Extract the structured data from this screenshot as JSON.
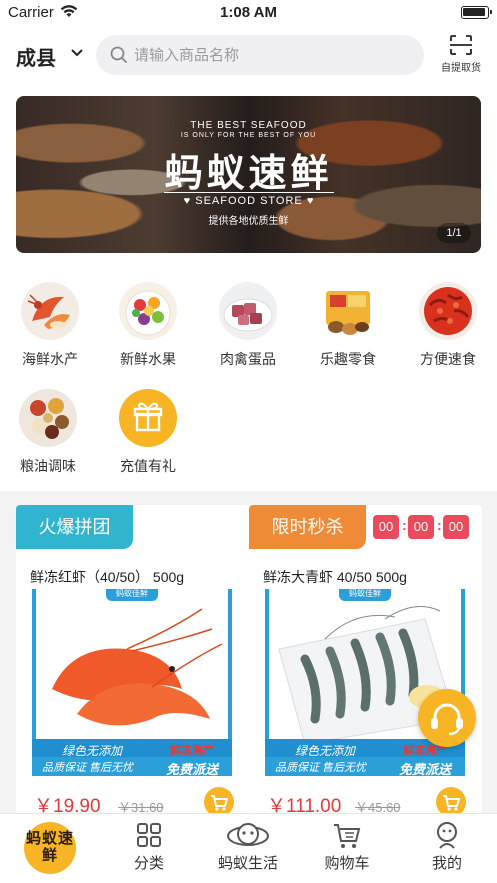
{
  "status_bar": {
    "carrier": "Carrier",
    "time": "1:08 AM"
  },
  "header": {
    "city": "成县",
    "search_placeholder": "请输入商品名称",
    "scan_label": "自提取货"
  },
  "banner": {
    "line1": "THE BEST SEAFOOD",
    "line2": "IS ONLY FOR THE BEST OF YOU",
    "title": "蚂蚁速鲜",
    "store": "♥ SEAFOOD STORE ♥",
    "subtitle": "提供各地优质生鲜",
    "pager": "1/1"
  },
  "categories": [
    {
      "label": "海鲜水产",
      "icon": "seafood-icon"
    },
    {
      "label": "新鲜水果",
      "icon": "fruit-icon"
    },
    {
      "label": "肉禽蛋品",
      "icon": "meat-icon"
    },
    {
      "label": "乐趣零食",
      "icon": "snack-icon"
    },
    {
      "label": "方便速食",
      "icon": "crayfish-icon"
    },
    {
      "label": "粮油调味",
      "icon": "spice-icon"
    },
    {
      "label": "充值有礼",
      "icon": "gift-icon"
    }
  ],
  "group_buy": {
    "tag": "火爆拼团",
    "name": "鲜冻红虾（40/50） 500g",
    "price": "￥19.90",
    "old_price": "￥31.60"
  },
  "flash_sale": {
    "tag": "限时秒杀",
    "timer": [
      "00",
      "00",
      "00"
    ],
    "name": "鲜冻大青虾 40/50 500g",
    "price": "￥111.00",
    "old_price": "￥45.60"
  },
  "product_image_text": {
    "badge": "蚂蚁佳鲜",
    "line1": "绿色无添加",
    "line2": "品质保证 售后无忧",
    "brand": "鲜冻海产",
    "delivery": "免费派送"
  },
  "colors": {
    "accent": "#f7b525",
    "group_tag": "#31b4cd",
    "flash_tag": "#ef8a36",
    "price": "#e23a3a"
  },
  "tabbar": {
    "home": "蚂蚁速鲜",
    "items": [
      {
        "label": "分类",
        "icon": "grid-icon"
      },
      {
        "label": "蚂蚁生活",
        "icon": "ant-life-icon"
      },
      {
        "label": "购物车",
        "icon": "cart-icon"
      },
      {
        "label": "我的",
        "icon": "profile-icon"
      }
    ]
  }
}
